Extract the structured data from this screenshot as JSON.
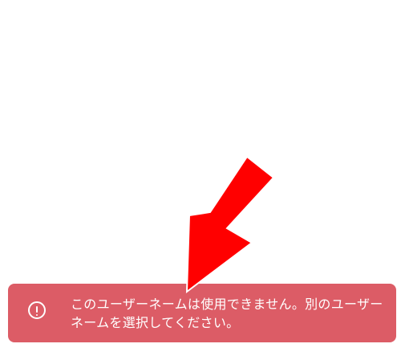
{
  "toast": {
    "icon": "exclamation-circle-icon",
    "message": "このユーザーネームは使用できません。別のユーザーネームを選択してください。",
    "background_color": "#dc5c66",
    "text_color": "#ffffff"
  },
  "annotation": {
    "icon": "red-arrow-icon",
    "color": "#ff0000"
  }
}
